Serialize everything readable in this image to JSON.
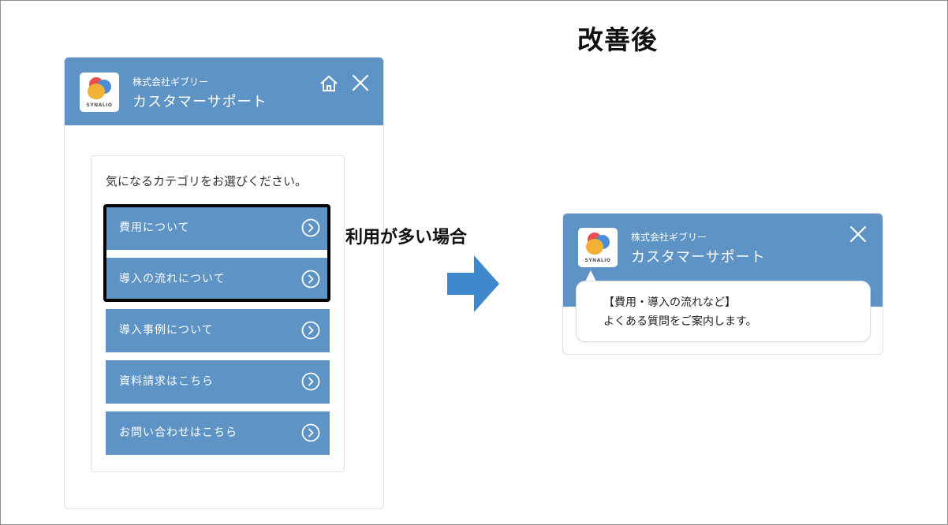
{
  "heading": "改善後",
  "middle_label": "利用が多い場合",
  "left_widget": {
    "logo_text": "SYNALIO",
    "company": "株式会社ギブリー",
    "service": "カスタマーサポート",
    "prompt": "気になるカテゴリをお選びください。",
    "options": [
      {
        "label": "費用について"
      },
      {
        "label": "導入の流れについて"
      },
      {
        "label": "導入事例について"
      },
      {
        "label": "資料請求はこちら"
      },
      {
        "label": "お問い合わせはこちら"
      }
    ]
  },
  "right_widget": {
    "logo_text": "SYNALIO",
    "company": "株式会社ギブリー",
    "service": "カスタマーサポート",
    "bubble_line1": "【費用・導入の流れなど】",
    "bubble_line2": "よくある質問をご案内します。"
  },
  "colors": {
    "header": "#5e93c5",
    "arrow": "#3f88cd",
    "highlight": "#000000"
  },
  "icons": [
    "home-icon",
    "close-icon",
    "chevron-right-circle-icon",
    "arrow-right-icon"
  ]
}
